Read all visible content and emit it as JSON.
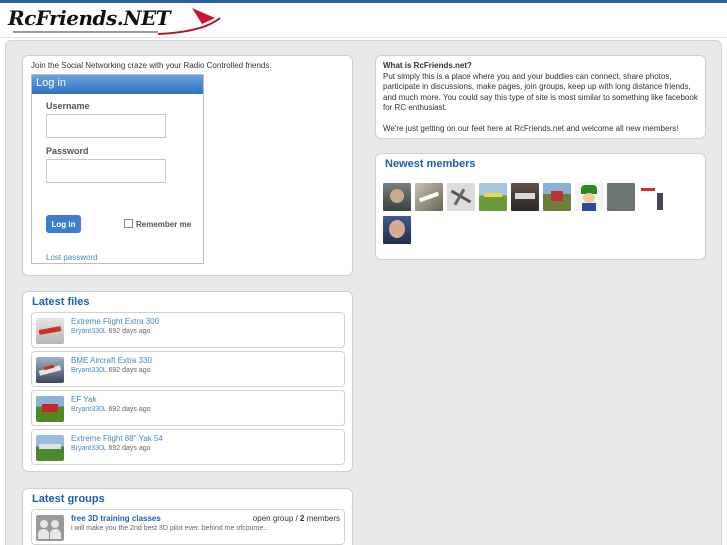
{
  "header": {
    "logo_text": "RcFriends.NET"
  },
  "intro": "Join the Social Networking craze with your Radio Controlled friends.",
  "login": {
    "title": "Log in",
    "username_label": "Username",
    "password_label": "Password",
    "button": "Log in",
    "remember": "Remember me",
    "lost_password": "Lost password"
  },
  "about": {
    "title": "What is RcFriends.net?",
    "text": "Put simply this is a place where you and your buddies can connect, share photos, participate in discussions, make pages, join groups, keep up with long distance friends, and much more. You could say this type of site is most similar to something like facebook for RC enthusiast.",
    "text2": "We're just getting on our feet here at RcFriends.net and welcome all new members!"
  },
  "newest_members": {
    "title": "Newest members"
  },
  "latest_files": {
    "title": "Latest files",
    "items": [
      {
        "title": "Extreme Flight Extra 300",
        "user": "Bryant330L",
        "age": "692 days ago"
      },
      {
        "title": "BME Aircraft Extra 330",
        "user": "Bryant330L",
        "age": "692 days ago"
      },
      {
        "title": "EF Yak",
        "user": "Bryant330L",
        "age": "692 days ago"
      },
      {
        "title": "Extreme Flight 88\" Yak 54",
        "user": "Bryant330L",
        "age": "692 days ago"
      }
    ]
  },
  "latest_groups": {
    "title": "Latest groups",
    "items": [
      {
        "title": "free 3D training classes",
        "description": "i will make you the 2nd best 3D pilot ever. behind me ofcoume...",
        "type": "open group /",
        "count": "2",
        "members": "members"
      }
    ]
  }
}
